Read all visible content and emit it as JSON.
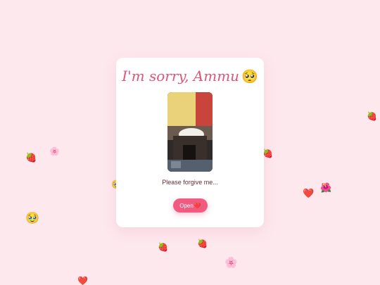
{
  "card": {
    "title": "I'm sorry, Ammu",
    "title_emoji": "🥺",
    "caption": "Please forgive me...",
    "button_label": "Open",
    "button_emoji": "❤️"
  },
  "floaters": {
    "strawberry": "🍓",
    "flower": "🌸",
    "heart": "❤️",
    "cute_face": "🥹",
    "hibiscus": "🌺"
  },
  "colors": {
    "background": "#fde8ee",
    "accent": "#f25b80",
    "title": "#e0557a"
  }
}
